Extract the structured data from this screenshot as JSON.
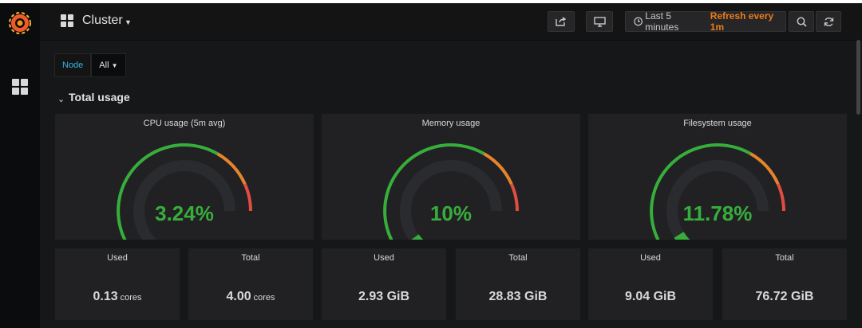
{
  "navbar": {
    "title": "Cluster",
    "time_range": "Last 5 minutes",
    "refresh": "Refresh every 1m"
  },
  "variables": {
    "label": "Node",
    "value": "All"
  },
  "row": {
    "title": "Total usage"
  },
  "gauges": [
    {
      "title": "CPU usage (5m avg)",
      "value": "3.24%",
      "fraction": 0.0324
    },
    {
      "title": "Memory usage",
      "value": "10%",
      "fraction": 0.1
    },
    {
      "title": "Filesystem usage",
      "value": "11.78%",
      "fraction": 0.1178
    }
  ],
  "stats": [
    {
      "title": "Used",
      "value": "0.13",
      "unit": "cores"
    },
    {
      "title": "Total",
      "value": "4.00",
      "unit": "cores"
    },
    {
      "title": "Used",
      "value": "2.93 GiB",
      "unit": ""
    },
    {
      "title": "Total",
      "value": "28.83 GiB",
      "unit": ""
    },
    {
      "title": "Used",
      "value": "9.04 GiB",
      "unit": ""
    },
    {
      "title": "Total",
      "value": "76.72 GiB",
      "unit": ""
    }
  ],
  "colors": {
    "ok": "#37ae3c",
    "warn": "#e6842b",
    "crit": "#e24d42",
    "track": "#2a2b2e",
    "refresh": "#eb7b18",
    "var_label": "#33b5e5"
  },
  "icons": {
    "logo": "grafana-logo",
    "dashboards": "dashboards-icon",
    "share": "share-icon",
    "tv": "tv-mode-icon",
    "clock": "clock-icon",
    "zoom": "zoom-out-icon",
    "refresh": "refresh-icon"
  }
}
